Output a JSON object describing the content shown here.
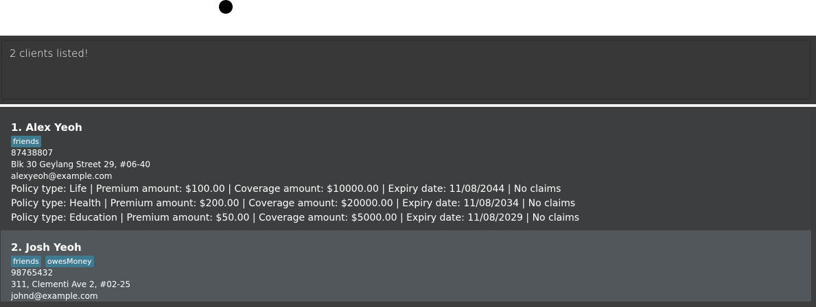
{
  "status": {
    "message": "2 clients listed!"
  },
  "clients": [
    {
      "name": "1. Alex Yeoh",
      "tags": [
        "friends"
      ],
      "phone": "87438807",
      "address": "Blk 30 Geylang Street 29, #06-40",
      "email": "alexyeoh@example.com",
      "policies": [
        "Policy type: Life | Premium amount: $100.00 | Coverage amount: $10000.00 | Expiry date: 11/08/2044 | No claims",
        "Policy type: Health | Premium amount: $200.00 | Coverage amount: $20000.00 | Expiry date: 11/08/2034 | No claims",
        "Policy type: Education | Premium amount: $50.00 | Coverage amount: $5000.00 | Expiry date: 11/08/2029 | No claims"
      ]
    },
    {
      "name": "2. Josh Yeoh",
      "tags": [
        "friends",
        "owesMoney"
      ],
      "phone": "98765432",
      "address": "311, Clementi Ave 2, #02-25",
      "email": "johnd@example.com",
      "policies": []
    }
  ],
  "colors": {
    "panel_bg": "#383838",
    "card_default": "#3c3e3f",
    "card_selected": "#505659",
    "tag_bg": "#3e7b91"
  }
}
